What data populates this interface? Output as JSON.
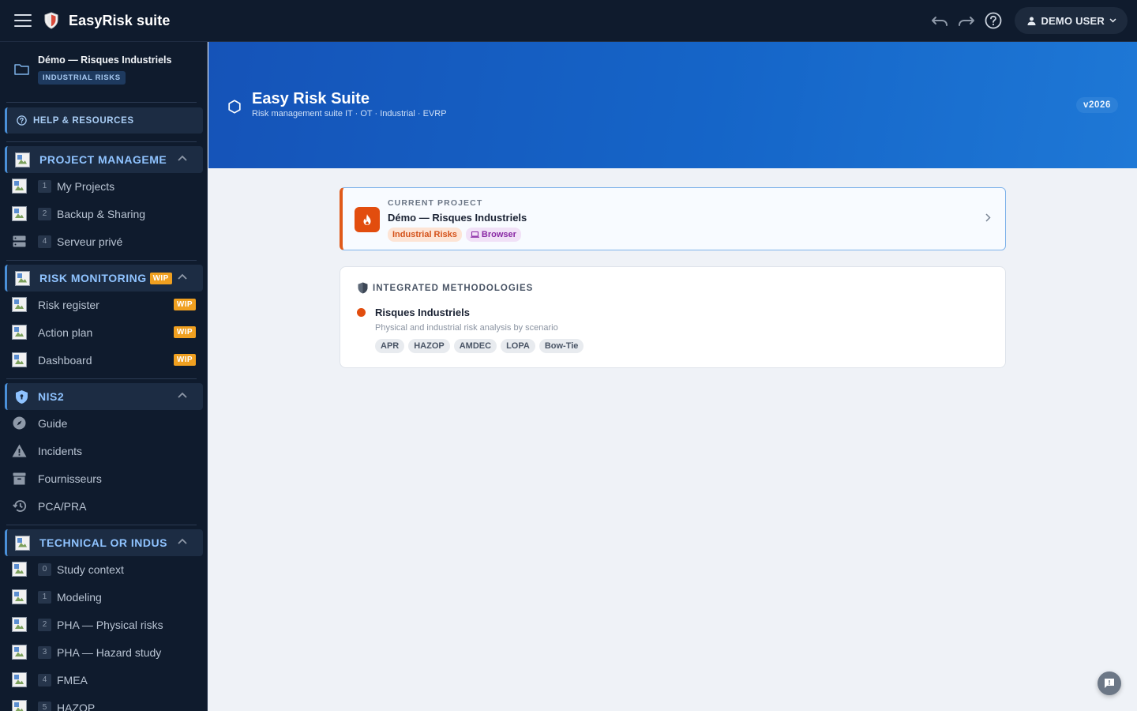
{
  "app": {
    "title": "EasyRisk suite"
  },
  "topbar": {
    "user_label": "DEMO USER"
  },
  "sidebar": {
    "project_name": "Démo — Risques Industriels",
    "project_tag": "INDUSTRIAL RISKS",
    "help_label": "HELP & RESOURCES",
    "sections": [
      {
        "label": "PROJECT MANAGEMEN",
        "items": [
          {
            "num": "1",
            "label": "My Projects"
          },
          {
            "num": "2",
            "label": "Backup & Sharing"
          },
          {
            "num": "4",
            "label": "Serveur privé"
          }
        ]
      },
      {
        "label": "RISK MONITORING",
        "wip": "WIP",
        "items": [
          {
            "label": "Risk register",
            "wip": "WIP"
          },
          {
            "label": "Action plan",
            "wip": "WIP"
          },
          {
            "label": "Dashboard",
            "wip": "WIP"
          }
        ]
      },
      {
        "label": "NIS2",
        "items": [
          {
            "label": "Guide"
          },
          {
            "label": "Incidents"
          },
          {
            "label": "Fournisseurs"
          },
          {
            "label": "PCA/PRA"
          }
        ]
      },
      {
        "label": "TECHNICAL OR INDUSTI",
        "items": [
          {
            "num": "0",
            "label": "Study context"
          },
          {
            "num": "1",
            "label": "Modeling"
          },
          {
            "num": "2",
            "label": "PHA — Physical risks"
          },
          {
            "num": "3",
            "label": "PHA — Hazard study"
          },
          {
            "num": "4",
            "label": "FMEA"
          },
          {
            "num": "5",
            "label": "HAZOP"
          }
        ]
      }
    ]
  },
  "banner": {
    "title": "Easy Risk Suite",
    "subtitle": "Risk management suite IT · OT · Industrial · EVRP",
    "version": "v2026"
  },
  "current_project": {
    "label": "CURRENT PROJECT",
    "name": "Démo — Risques Industriels",
    "tag_domain": "Industrial Risks",
    "tag_storage": "Browser"
  },
  "methodologies": {
    "heading": "INTEGRATED METHODOLOGIES",
    "items": [
      {
        "title": "Risques Industriels",
        "description": "Physical and industrial risk analysis by scenario",
        "tags": [
          "APR",
          "HAZOP",
          "AMDEC",
          "LOPA",
          "Bow-Tie"
        ]
      }
    ]
  },
  "colors": {
    "accent": "#1565c8",
    "industrial": "#e24d0e",
    "wip": "#f0a020",
    "sidebar_bg": "#0f1b2d"
  }
}
